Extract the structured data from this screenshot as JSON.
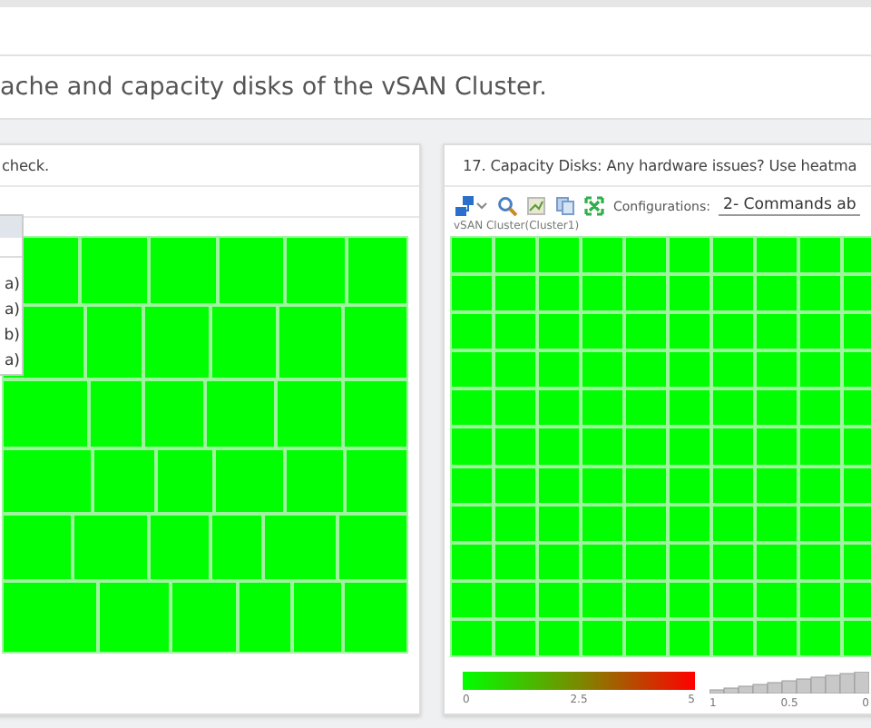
{
  "heading": "ache and capacity disks of the vSAN Cluster.",
  "panels": [
    {
      "title": "check.",
      "menu_items": [
        "a)",
        "a)",
        "b)",
        "a)"
      ]
    },
    {
      "title": "17. Capacity Disks: Any hardware issues? Use heatma",
      "config_label": "Configurations:",
      "config_value": "2- Commands ab",
      "breadcrumb": "vSAN Cluster(Cluster1)",
      "color_ticks": [
        "0",
        "2.5",
        "5"
      ],
      "size_ticks": [
        "1",
        "0.5",
        "0"
      ]
    }
  ]
}
